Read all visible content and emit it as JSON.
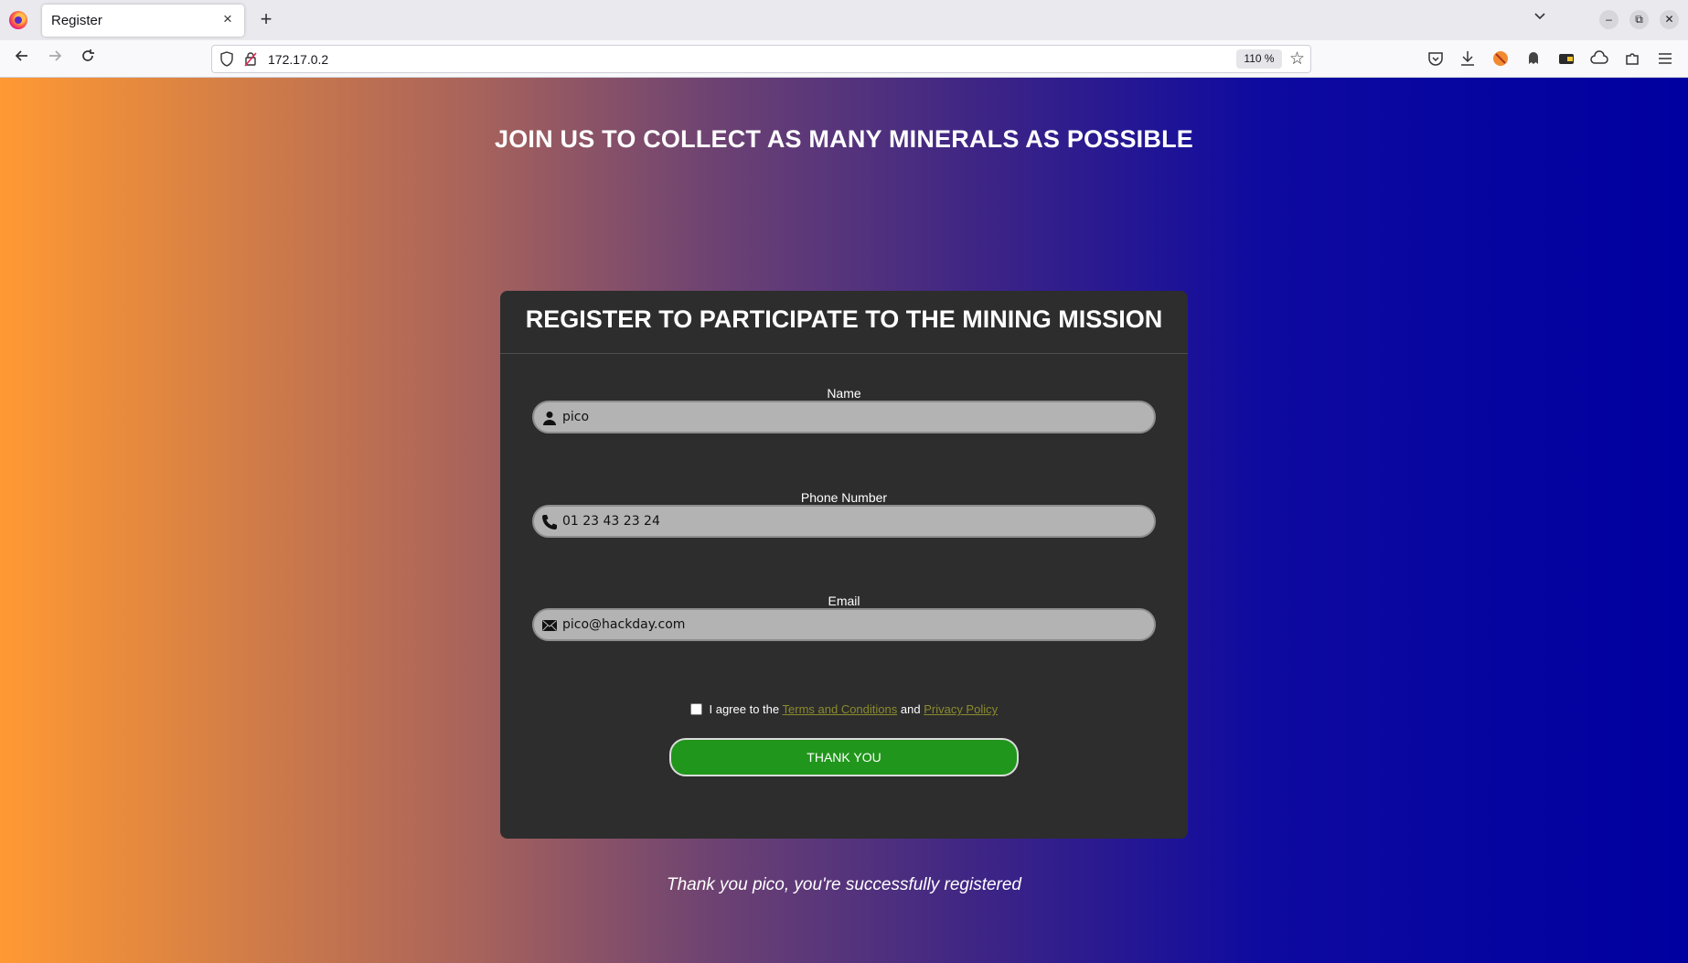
{
  "browser": {
    "tab_title": "Register",
    "tab_close": "×",
    "new_tab": "+",
    "tab_list": "⌄",
    "url": "172.17.0.2",
    "zoom": "110 %",
    "window_buttons": [
      "–",
      "⧉",
      "✕"
    ]
  },
  "page": {
    "hero_title": "JOIN US TO COLLECT AS MANY MINERALS AS POSSIBLE",
    "form": {
      "title": "REGISTER TO PARTICIPATE TO THE MINING MISSION",
      "name_label": "Name",
      "name_value": "pico",
      "phone_label": "Phone Number",
      "phone_value": "01 23 43 23 24",
      "email_label": "Email",
      "email_value": "pico@hackday.com",
      "agree_prefix": "I agree to the",
      "terms_link": "Terms and Conditions",
      "agree_and": "and",
      "privacy_link": "Privacy Policy",
      "submit_label": "THANK YOU"
    },
    "success_message": "Thank you pico, you're successfully registered"
  },
  "colors": {
    "gradient_start": "#ff9933",
    "gradient_end": "#0000a0",
    "card_bg": "#2d2d2d",
    "submit_bg": "#21961c",
    "link": "#8b8b2e"
  },
  "icons": {
    "name_field": "person-icon",
    "phone_field": "phone-icon",
    "email_field": "envelope-icon"
  }
}
